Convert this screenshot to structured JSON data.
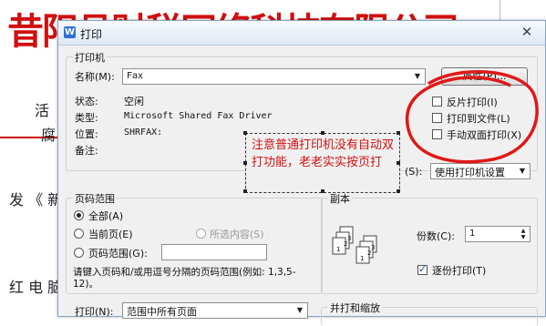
{
  "doc": {
    "heading": "昔阳县财税网络科技有限公司",
    "line1": "发 《 新",
    "line2": "红 电 脑",
    "side_char": "活",
    "side_char2": "腐"
  },
  "dialog": {
    "title": "打印",
    "app_icon": "W",
    "close_glyph": "✕",
    "printer_group": "打印机",
    "name_label": "名称(M):",
    "printer_name": "Fax",
    "properties_button": "属性(P)...",
    "status_label": "状态:",
    "status_value": "空闲",
    "type_label": "类型:",
    "type_value": "Microsoft Shared Fax Driver",
    "location_label": "位置:",
    "location_value": "SHRFAX:",
    "comment_label": "备注:",
    "reverse_print": "反片打印(I)",
    "print_to_file": "打印到文件(L)",
    "manual_duplex": "手动双面打印(X)",
    "paper_source_label": "(S):",
    "paper_source_value": "使用打印机设置",
    "page_range_group": "页码范围",
    "range_all": "全部(A)",
    "range_current": "当前页(E)",
    "range_selection": "所选内容(S)",
    "range_pages": "页码范围(G):",
    "range_hint": "请键入页码和/或用逗号分隔的页码范围(例如: 1,3,5-12)。",
    "copies_group": "副本",
    "copies_label": "份数(C):",
    "copies_value": "1",
    "collate_label": "逐份打印(T)",
    "print_label": "打印(N):",
    "print_value": "范围中所有页面",
    "merge_group": "并打和缩放"
  },
  "annotation": {
    "text": "注意普通打印机没有自动双打功能，老老实实按页打"
  },
  "colors": {
    "accent_red": "#d01010",
    "title_gradient_top": "#f8fbff",
    "dialog_bg": "#f0f0f0"
  },
  "icons": [
    "app-icon",
    "close-icon",
    "dropdown-arrow-icon",
    "collate-pages-icon"
  ]
}
